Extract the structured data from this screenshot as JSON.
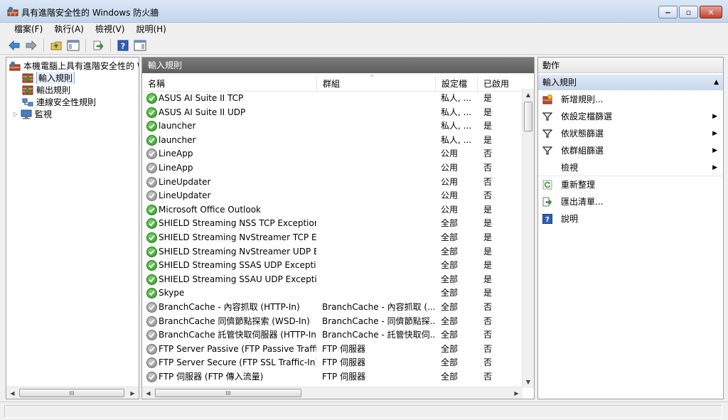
{
  "window": {
    "title": "具有進階安全性的 Windows 防火牆",
    "buttons": {
      "minimize": "‒",
      "maximize": "▫",
      "close": "✕"
    }
  },
  "menu": [
    "檔案(F)",
    "執行(A)",
    "檢視(V)",
    "說明(H)"
  ],
  "toolbar": [
    "back-arrow-icon",
    "forward-arrow-icon",
    "up-folder-icon",
    "show-hide-tree-icon",
    "export-list-icon",
    "help-icon",
    "show-hide-action-pane-icon"
  ],
  "tree": {
    "root": "本機電腦上具有進階安全性的 W",
    "items": [
      {
        "label": "輸入規則",
        "icon": "inbound-rules-icon",
        "selected": true
      },
      {
        "label": "輸出規則",
        "icon": "outbound-rules-icon",
        "selected": false
      },
      {
        "label": "連線安全性規則",
        "icon": "connection-security-icon",
        "selected": false
      },
      {
        "label": "監視",
        "icon": "monitor-icon",
        "selected": false
      }
    ],
    "scroll": {
      "left": "◀",
      "right": "▶",
      "grip": "III"
    }
  },
  "center": {
    "title": "輸入規則",
    "columns": {
      "name": "名稱",
      "group": "群組",
      "profile": "設定檔",
      "enabled": "已啟用"
    },
    "sort_indicator": "^",
    "rows": [
      {
        "name": "ASUS AI Suite II TCP",
        "group": "",
        "profile": "私人, ...",
        "enabled": "是",
        "on": true
      },
      {
        "name": "ASUS AI Suite II UDP",
        "group": "",
        "profile": "私人, ...",
        "enabled": "是",
        "on": true
      },
      {
        "name": "launcher",
        "group": "",
        "profile": "私人, ...",
        "enabled": "是",
        "on": true
      },
      {
        "name": "launcher",
        "group": "",
        "profile": "私人, ...",
        "enabled": "是",
        "on": true
      },
      {
        "name": "LineApp",
        "group": "",
        "profile": "公用",
        "enabled": "否",
        "on": false
      },
      {
        "name": "LineApp",
        "group": "",
        "profile": "公用",
        "enabled": "否",
        "on": false
      },
      {
        "name": "LineUpdater",
        "group": "",
        "profile": "公用",
        "enabled": "否",
        "on": false
      },
      {
        "name": "LineUpdater",
        "group": "",
        "profile": "公用",
        "enabled": "否",
        "on": false
      },
      {
        "name": "Microsoft Office Outlook",
        "group": "",
        "profile": "公用",
        "enabled": "是",
        "on": true
      },
      {
        "name": "SHIELD Streaming NSS TCP Exception",
        "group": "",
        "profile": "全部",
        "enabled": "是",
        "on": true
      },
      {
        "name": "SHIELD Streaming NvStreamer TCP Ex...",
        "group": "",
        "profile": "全部",
        "enabled": "是",
        "on": true
      },
      {
        "name": "SHIELD Streaming NvStreamer UDP Ex...",
        "group": "",
        "profile": "全部",
        "enabled": "是",
        "on": true
      },
      {
        "name": "SHIELD Streaming SSAS UDP Exception",
        "group": "",
        "profile": "全部",
        "enabled": "是",
        "on": true
      },
      {
        "name": "SHIELD Streaming SSAU UDP Exception",
        "group": "",
        "profile": "全部",
        "enabled": "是",
        "on": true
      },
      {
        "name": "Skype",
        "group": "",
        "profile": "全部",
        "enabled": "是",
        "on": true
      },
      {
        "name": "BranchCache - 內容抓取 (HTTP-In)",
        "group": "BranchCache - 內容抓取 (...",
        "profile": "全部",
        "enabled": "否",
        "on": false
      },
      {
        "name": "BranchCache 同儕節點探索 (WSD-In)",
        "group": "BranchCache - 同儕節點探...",
        "profile": "全部",
        "enabled": "否",
        "on": false
      },
      {
        "name": "BranchCache 託管快取伺服器 (HTTP-In)",
        "group": "BranchCache - 託管快取伺...",
        "profile": "全部",
        "enabled": "否",
        "on": false
      },
      {
        "name": "FTP Server Passive (FTP Passive Traffic-I...",
        "group": "FTP 伺服器",
        "profile": "全部",
        "enabled": "否",
        "on": false
      },
      {
        "name": "FTP Server Secure (FTP SSL Traffic-In)",
        "group": "FTP 伺服器",
        "profile": "全部",
        "enabled": "否",
        "on": false
      },
      {
        "name": "FTP 伺服器 (FTP 傳入流量)",
        "group": "FTP 伺服器",
        "profile": "全部",
        "enabled": "否",
        "on": false
      }
    ],
    "hscroll": {
      "left": "◀",
      "right": "▶",
      "grip": "III"
    },
    "vscroll": {
      "up": "▲",
      "down": "▼"
    }
  },
  "actions": {
    "title": "動作",
    "section": "輸入規則",
    "collapse": "▲",
    "items": [
      {
        "label": "新增規則...",
        "icon": "new-rule-icon",
        "submenu": false
      },
      {
        "label": "依設定檔篩選",
        "icon": "filter-icon",
        "submenu": true
      },
      {
        "label": "依狀態篩選",
        "icon": "filter-icon",
        "submenu": true
      },
      {
        "label": "依群組篩選",
        "icon": "filter-icon",
        "submenu": true
      },
      {
        "label": "檢視",
        "icon": "",
        "submenu": true
      },
      {
        "label": "重新整理",
        "icon": "refresh-icon",
        "submenu": false
      },
      {
        "label": "匯出清單...",
        "icon": "export-list-icon",
        "submenu": false
      },
      {
        "label": "說明",
        "icon": "help-icon",
        "submenu": false
      }
    ],
    "submenu_arrow": "▶"
  },
  "colors": {
    "enabled": "#2f9a22",
    "disabled": "#8a8a8a",
    "selection": "#e5f0fb"
  }
}
